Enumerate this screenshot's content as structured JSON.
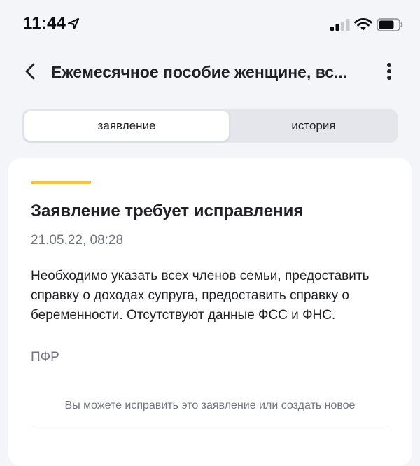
{
  "status_bar": {
    "time": "11:44"
  },
  "nav": {
    "title": "Ежемесячное пособие женщине, вс..."
  },
  "tabs": [
    {
      "label": "заявление",
      "active": true
    },
    {
      "label": "история",
      "active": false
    }
  ],
  "card": {
    "status_color": "#f0c24b",
    "title": "Заявление требует исправления",
    "date": "21.05.22, 08:28",
    "message": "Необходимо указать всех членов семьи, предоставить справку о доходах супруга, предоставить справку о беременности. Отсутствуют данные ФСС и ФНС.",
    "organization": "ПФР",
    "hint": "Вы можете исправить это заявление или создать новое"
  }
}
